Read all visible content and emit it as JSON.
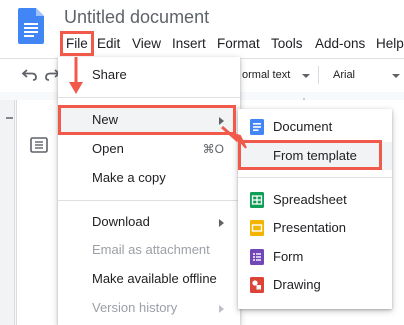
{
  "document": {
    "title": "Untitled document"
  },
  "menubar": {
    "items": [
      "File",
      "Edit",
      "View",
      "Insert",
      "Format",
      "Tools",
      "Add-ons",
      "Help"
    ]
  },
  "toolbar": {
    "style_label": "ormal text",
    "font_label": "Arial"
  },
  "file_menu": {
    "share": "Share",
    "new": "New",
    "open": "Open",
    "open_shortcut": "⌘O",
    "make_copy": "Make a copy",
    "download": "Download",
    "email_attachment": "Email as attachment",
    "make_offline": "Make available offline",
    "version_history": "Version history"
  },
  "new_submenu": {
    "document": "Document",
    "from_template": "From template",
    "spreadsheet": "Spreadsheet",
    "presentation": "Presentation",
    "form": "Form",
    "drawing": "Drawing"
  },
  "colors": {
    "docs_blue": "#4285f4",
    "sheets_green": "#0f9d58",
    "slides_yellow": "#f4b400",
    "forms_purple": "#7248b9",
    "drawings_red": "#db4437",
    "annotation": "#f15a4a",
    "hover": "#f1f3f4"
  }
}
